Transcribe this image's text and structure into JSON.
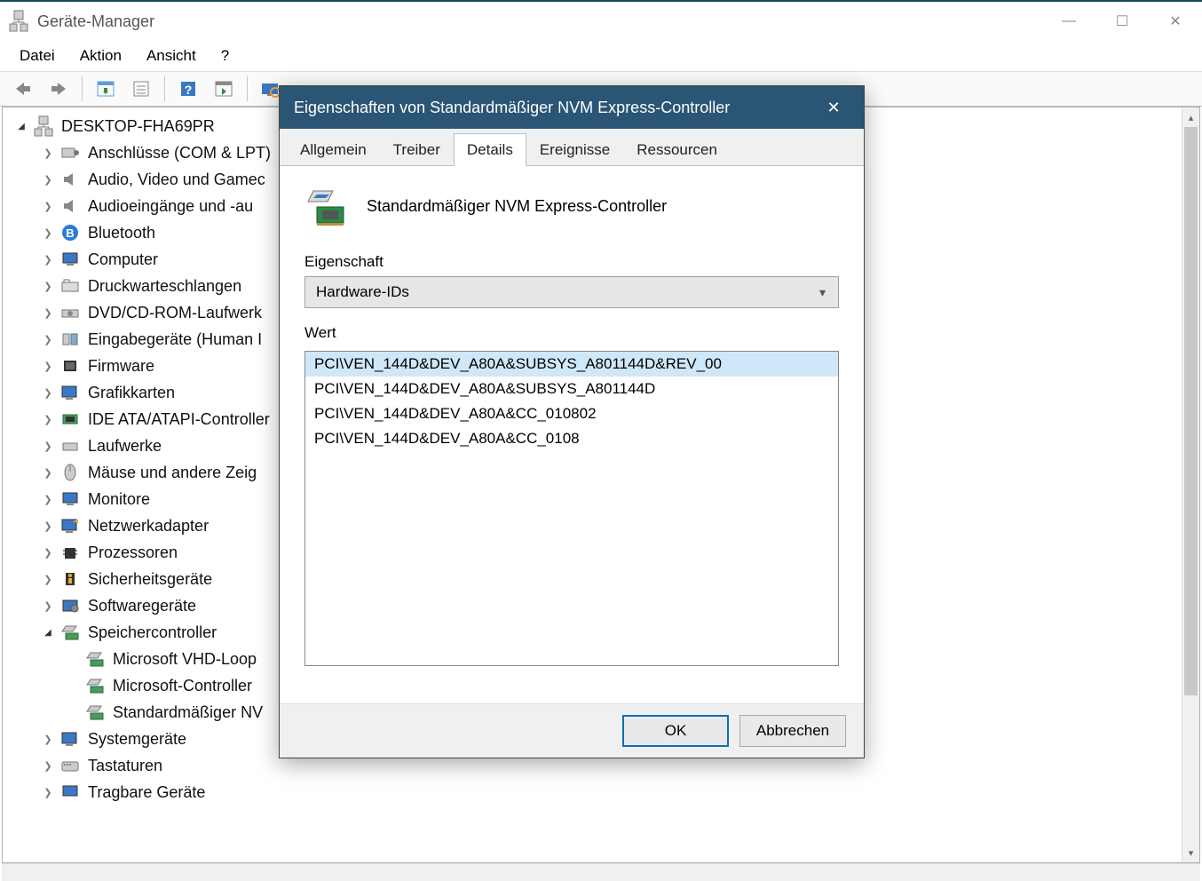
{
  "window": {
    "title": "Geräte-Manager"
  },
  "menu": [
    "Datei",
    "Aktion",
    "Ansicht",
    "?"
  ],
  "tree": {
    "root": "DESKTOP-FHA69PR",
    "categories": [
      {
        "label": "Anschlüsse (COM & LPT)"
      },
      {
        "label": "Audio, Video und Gamec"
      },
      {
        "label": "Audioeingänge und -au"
      },
      {
        "label": "Bluetooth"
      },
      {
        "label": "Computer"
      },
      {
        "label": "Druckwarteschlangen"
      },
      {
        "label": "DVD/CD-ROM-Laufwerk"
      },
      {
        "label": "Eingabegeräte (Human I"
      },
      {
        "label": "Firmware"
      },
      {
        "label": "Grafikkarten"
      },
      {
        "label": "IDE ATA/ATAPI-Controller"
      },
      {
        "label": "Laufwerke"
      },
      {
        "label": "Mäuse und andere Zeig"
      },
      {
        "label": "Monitore"
      },
      {
        "label": "Netzwerkadapter"
      },
      {
        "label": "Prozessoren"
      },
      {
        "label": "Sicherheitsgeräte"
      },
      {
        "label": "Softwaregeräte"
      },
      {
        "label": "Speichercontroller",
        "expanded": true,
        "children": [
          "Microsoft VHD-Loop",
          "Microsoft-Controller",
          "Standardmäßiger NV"
        ]
      },
      {
        "label": "Systemgeräte"
      },
      {
        "label": "Tastaturen"
      },
      {
        "label": "Tragbare Geräte"
      }
    ]
  },
  "dialog": {
    "title": "Eigenschaften von Standardmäßiger NVM Express-Controller",
    "tabs": [
      "Allgemein",
      "Treiber",
      "Details",
      "Ereignisse",
      "Ressourcen"
    ],
    "active_tab": "Details",
    "device_name": "Standardmäßiger NVM Express-Controller",
    "property_label": "Eigenschaft",
    "property_value": "Hardware-IDs",
    "value_label": "Wert",
    "values": [
      "PCI\\VEN_144D&DEV_A80A&SUBSYS_A801144D&REV_00",
      "PCI\\VEN_144D&DEV_A80A&SUBSYS_A801144D",
      "PCI\\VEN_144D&DEV_A80A&CC_010802",
      "PCI\\VEN_144D&DEV_A80A&CC_0108"
    ],
    "buttons": {
      "ok": "OK",
      "cancel": "Abbrechen"
    }
  }
}
